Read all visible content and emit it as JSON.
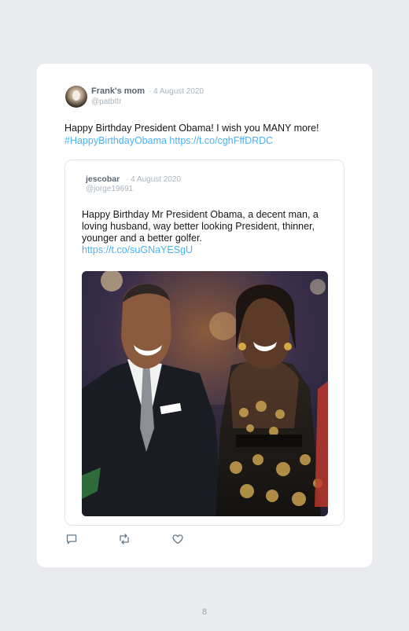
{
  "tweet": {
    "author_name": "Frank's mom",
    "date": "· 4 August 2020",
    "handle": "@patbttr",
    "text": "Happy Birthday President Obama! I wish you MANY more!",
    "hashtag": "#HappyBirthdayObama",
    "link": "https://t.co/cghFffDRDC"
  },
  "quoted": {
    "author_name": "jescobar",
    "date": "· 4 August 2020",
    "handle": "@jorge19691",
    "text": "Happy Birthday Mr President Obama, a decent man, a loving husband, way better looking President, thinner, younger and a better golfer.",
    "link": "https://t.co/suGNaYESgU"
  },
  "actions": {
    "icons": [
      "reply-icon",
      "retweet-icon",
      "like-icon"
    ]
  },
  "page_number": "8",
  "colors": {
    "background": "#eaebee",
    "card": "#ffffff",
    "link": "#4ab3f4",
    "muted": "#aab4bd"
  }
}
